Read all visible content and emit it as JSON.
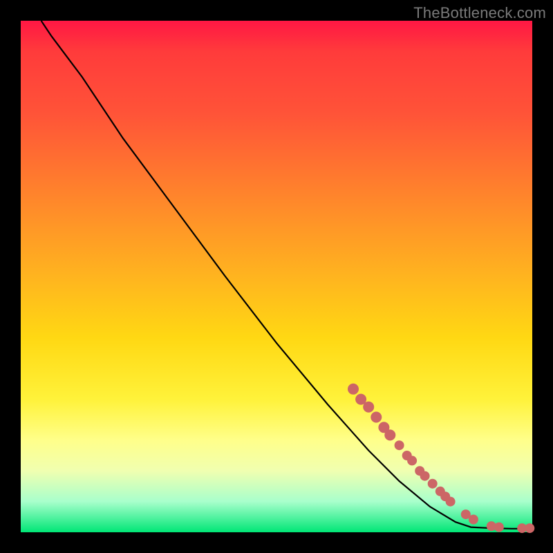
{
  "attribution": "TheBottleneck.com",
  "colors": {
    "marker": "#cc6666",
    "curve": "#000000",
    "background": "#000000"
  },
  "chart_data": {
    "type": "line",
    "title": "",
    "xlabel": "",
    "ylabel": "",
    "xlim": [
      0,
      100
    ],
    "ylim": [
      0,
      100
    ],
    "grid": false,
    "legend": false,
    "curve_points": [
      {
        "x": 4,
        "y": 100
      },
      {
        "x": 6,
        "y": 97
      },
      {
        "x": 9,
        "y": 93
      },
      {
        "x": 12,
        "y": 89
      },
      {
        "x": 20,
        "y": 77
      },
      {
        "x": 30,
        "y": 63.5
      },
      {
        "x": 40,
        "y": 50
      },
      {
        "x": 50,
        "y": 37
      },
      {
        "x": 60,
        "y": 25
      },
      {
        "x": 68,
        "y": 16
      },
      {
        "x": 74,
        "y": 10
      },
      {
        "x": 80,
        "y": 5
      },
      {
        "x": 85,
        "y": 2
      },
      {
        "x": 88,
        "y": 1
      },
      {
        "x": 92,
        "y": 0.8
      },
      {
        "x": 96,
        "y": 0.7
      },
      {
        "x": 100,
        "y": 0.7
      }
    ],
    "markers": [
      {
        "x": 65,
        "y": 28,
        "r": 8
      },
      {
        "x": 66.5,
        "y": 26,
        "r": 8
      },
      {
        "x": 68,
        "y": 24.5,
        "r": 8
      },
      {
        "x": 69.5,
        "y": 22.5,
        "r": 8
      },
      {
        "x": 71,
        "y": 20.5,
        "r": 8
      },
      {
        "x": 72.2,
        "y": 19,
        "r": 8
      },
      {
        "x": 74,
        "y": 17,
        "r": 7
      },
      {
        "x": 75.5,
        "y": 15,
        "r": 7
      },
      {
        "x": 76.5,
        "y": 14,
        "r": 7
      },
      {
        "x": 78,
        "y": 12,
        "r": 7
      },
      {
        "x": 79,
        "y": 11,
        "r": 7
      },
      {
        "x": 80.5,
        "y": 9.5,
        "r": 7
      },
      {
        "x": 82,
        "y": 8,
        "r": 7
      },
      {
        "x": 83,
        "y": 7,
        "r": 7
      },
      {
        "x": 84,
        "y": 6,
        "r": 7
      },
      {
        "x": 87,
        "y": 3.5,
        "r": 7
      },
      {
        "x": 88.5,
        "y": 2.5,
        "r": 7
      },
      {
        "x": 92,
        "y": 1.2,
        "r": 7
      },
      {
        "x": 93.5,
        "y": 1,
        "r": 7
      },
      {
        "x": 98,
        "y": 0.8,
        "r": 7
      },
      {
        "x": 99.5,
        "y": 0.8,
        "r": 7
      }
    ]
  }
}
